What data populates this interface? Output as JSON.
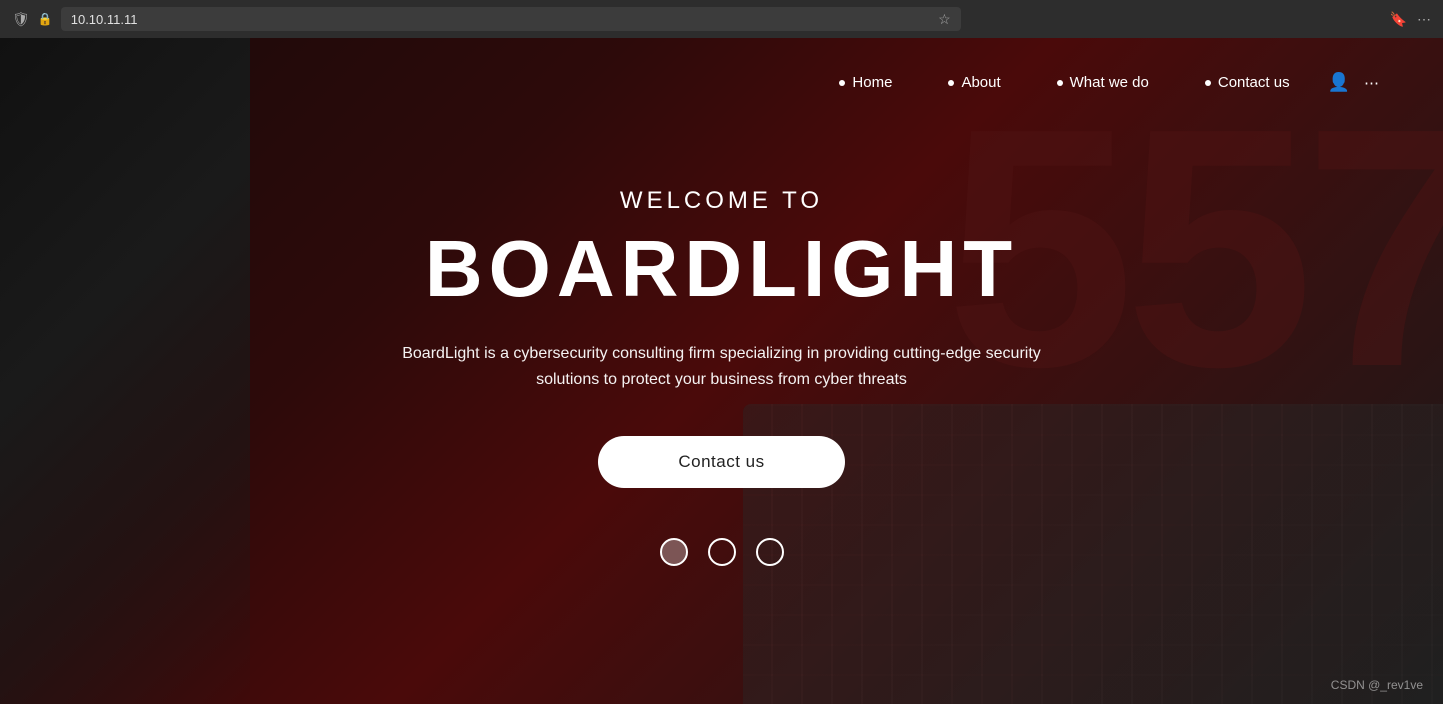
{
  "browser": {
    "url": "10.10.11.11",
    "shield_icon": "🛡",
    "lock_icon": "🔒",
    "star_icon": "☆"
  },
  "navbar": {
    "items": [
      {
        "label": "Home",
        "dot": true
      },
      {
        "label": "About",
        "dot": true
      },
      {
        "label": "What we do",
        "dot": true
      },
      {
        "label": "Contact us",
        "dot": true
      }
    ],
    "user_icon": "👤"
  },
  "hero": {
    "welcome_text": "WELCOME TO",
    "title": "BOARDLIGHT",
    "description": "BoardLight is a cybersecurity consulting firm specializing in providing cutting-edge security solutions to protect your business from cyber threats",
    "contact_button_label": "Contact us"
  },
  "carousel": {
    "dots": 3,
    "active_index": 0
  },
  "watermark": {
    "text": "CSDN @_rev1ve"
  },
  "decorative": {
    "number": "557"
  }
}
